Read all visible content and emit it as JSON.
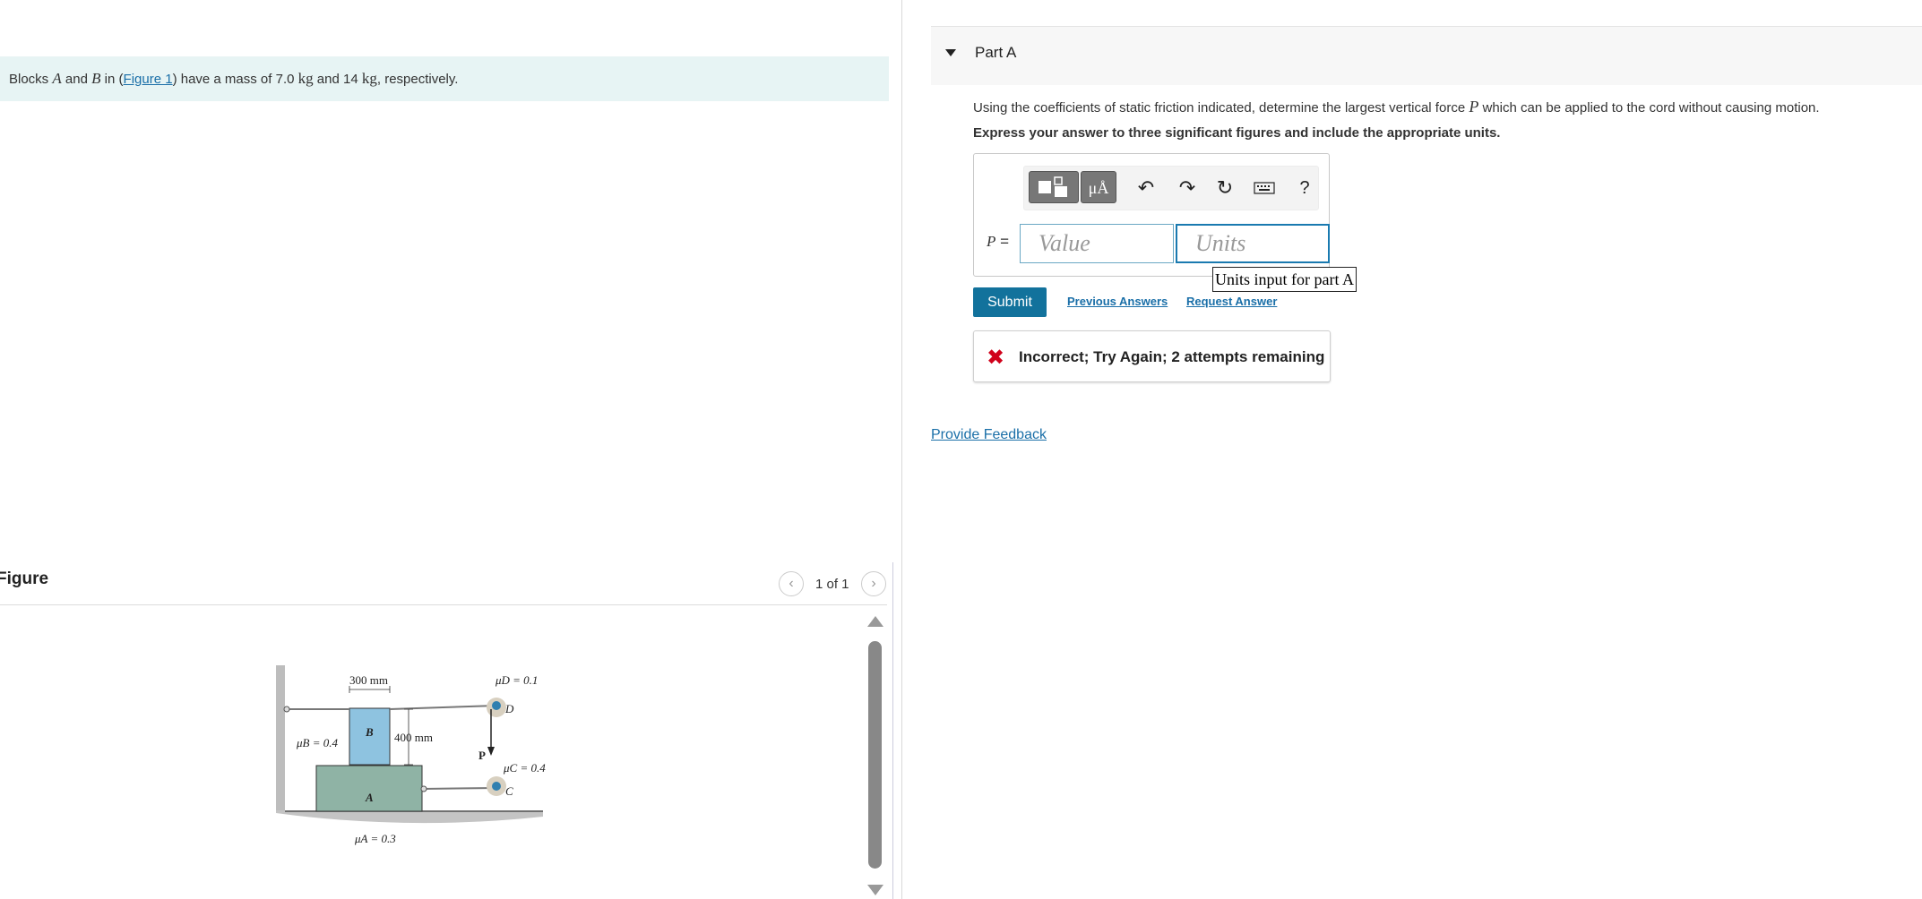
{
  "problem": {
    "prefix": "Blocks ",
    "var_a": "A",
    "and1": " and ",
    "var_b": "B",
    "in_open": " in (",
    "figure_link": "Figure 1",
    "close_mass": ") have a mass of 7.0 ",
    "unit1": "kg",
    "and2": " and 14 ",
    "unit2": "kg",
    "suffix": ", respectively."
  },
  "figure": {
    "title": "Figure",
    "pager": "1 of 1",
    "labels": {
      "dim_300": "300 mm",
      "dim_400": "400 mm",
      "mu_d": "μD = 0.1",
      "mu_b": "μB = 0.4",
      "mu_c": "μC = 0.4",
      "mu_a": "μA = 0.3",
      "block_b": "B",
      "block_a": "A",
      "pulley_d": "D",
      "pulley_c": "C",
      "force_p": "P"
    }
  },
  "part": {
    "title": "Part A",
    "question_pre": "Using the coefficients of static friction indicated, determine the largest vertical force ",
    "question_var": "P",
    "question_post": " which can be applied to the cord without causing motion.",
    "instructions": "Express your answer to three significant figures and include the appropriate units."
  },
  "answer": {
    "label_var": "P",
    "label_eq": " =",
    "value_placeholder": "Value",
    "units_placeholder": "Units",
    "units_tooltip": "Units input for part A",
    "units_button": "μÅ",
    "help": "?"
  },
  "actions": {
    "submit": "Submit",
    "previous_answers": "Previous Answers",
    "request_answer": "Request Answer"
  },
  "feedback": {
    "icon": "✖",
    "text": "Incorrect; Try Again; 2 attempts remaining"
  },
  "footer": {
    "provide_feedback": "Provide Feedback"
  },
  "colors": {
    "accent": "#12729c",
    "problem_bg": "#e7f4f4",
    "error": "#d0021b"
  }
}
